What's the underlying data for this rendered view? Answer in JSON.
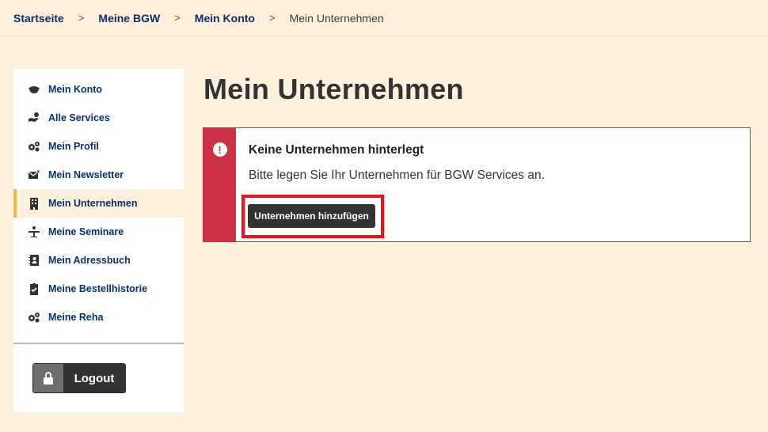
{
  "breadcrumb": {
    "items": [
      {
        "label": "Startseite"
      },
      {
        "label": "Meine BGW"
      },
      {
        "label": "Mein Konto"
      }
    ],
    "current": "Mein Unternehmen",
    "separator": ">"
  },
  "sidebar": {
    "items": [
      {
        "label": "Mein Konto",
        "icon": "handshake-icon"
      },
      {
        "label": "Alle Services",
        "icon": "hand-coin-icon"
      },
      {
        "label": "Mein Profil",
        "icon": "gears-icon"
      },
      {
        "label": "Mein Newsletter",
        "icon": "envelope-icon"
      },
      {
        "label": "Mein Unternehmen",
        "icon": "building-icon",
        "active": true
      },
      {
        "label": "Meine Seminare",
        "icon": "presentation-icon"
      },
      {
        "label": "Mein Adressbuch",
        "icon": "address-book-icon"
      },
      {
        "label": "Meine Bestellhistorie",
        "icon": "clipboard-check-icon"
      },
      {
        "label": "Meine Reha",
        "icon": "gears-icon"
      }
    ],
    "logout_label": "Logout"
  },
  "main": {
    "title": "Mein Unternehmen",
    "alert": {
      "icon": "exclamation-icon",
      "title": "Keine Unternehmen hinterlegt",
      "text": "Bitte legen Sie Ihr Unternehmen für BGW Services an.",
      "button_label": "Unternehmen hinzufügen"
    }
  },
  "colors": {
    "page_background": "#fdf0dc",
    "brand_navy": "#0b2f6b",
    "alert_red": "#cc3148",
    "active_accent": "#f2b64a",
    "highlight": "#e8131c"
  }
}
